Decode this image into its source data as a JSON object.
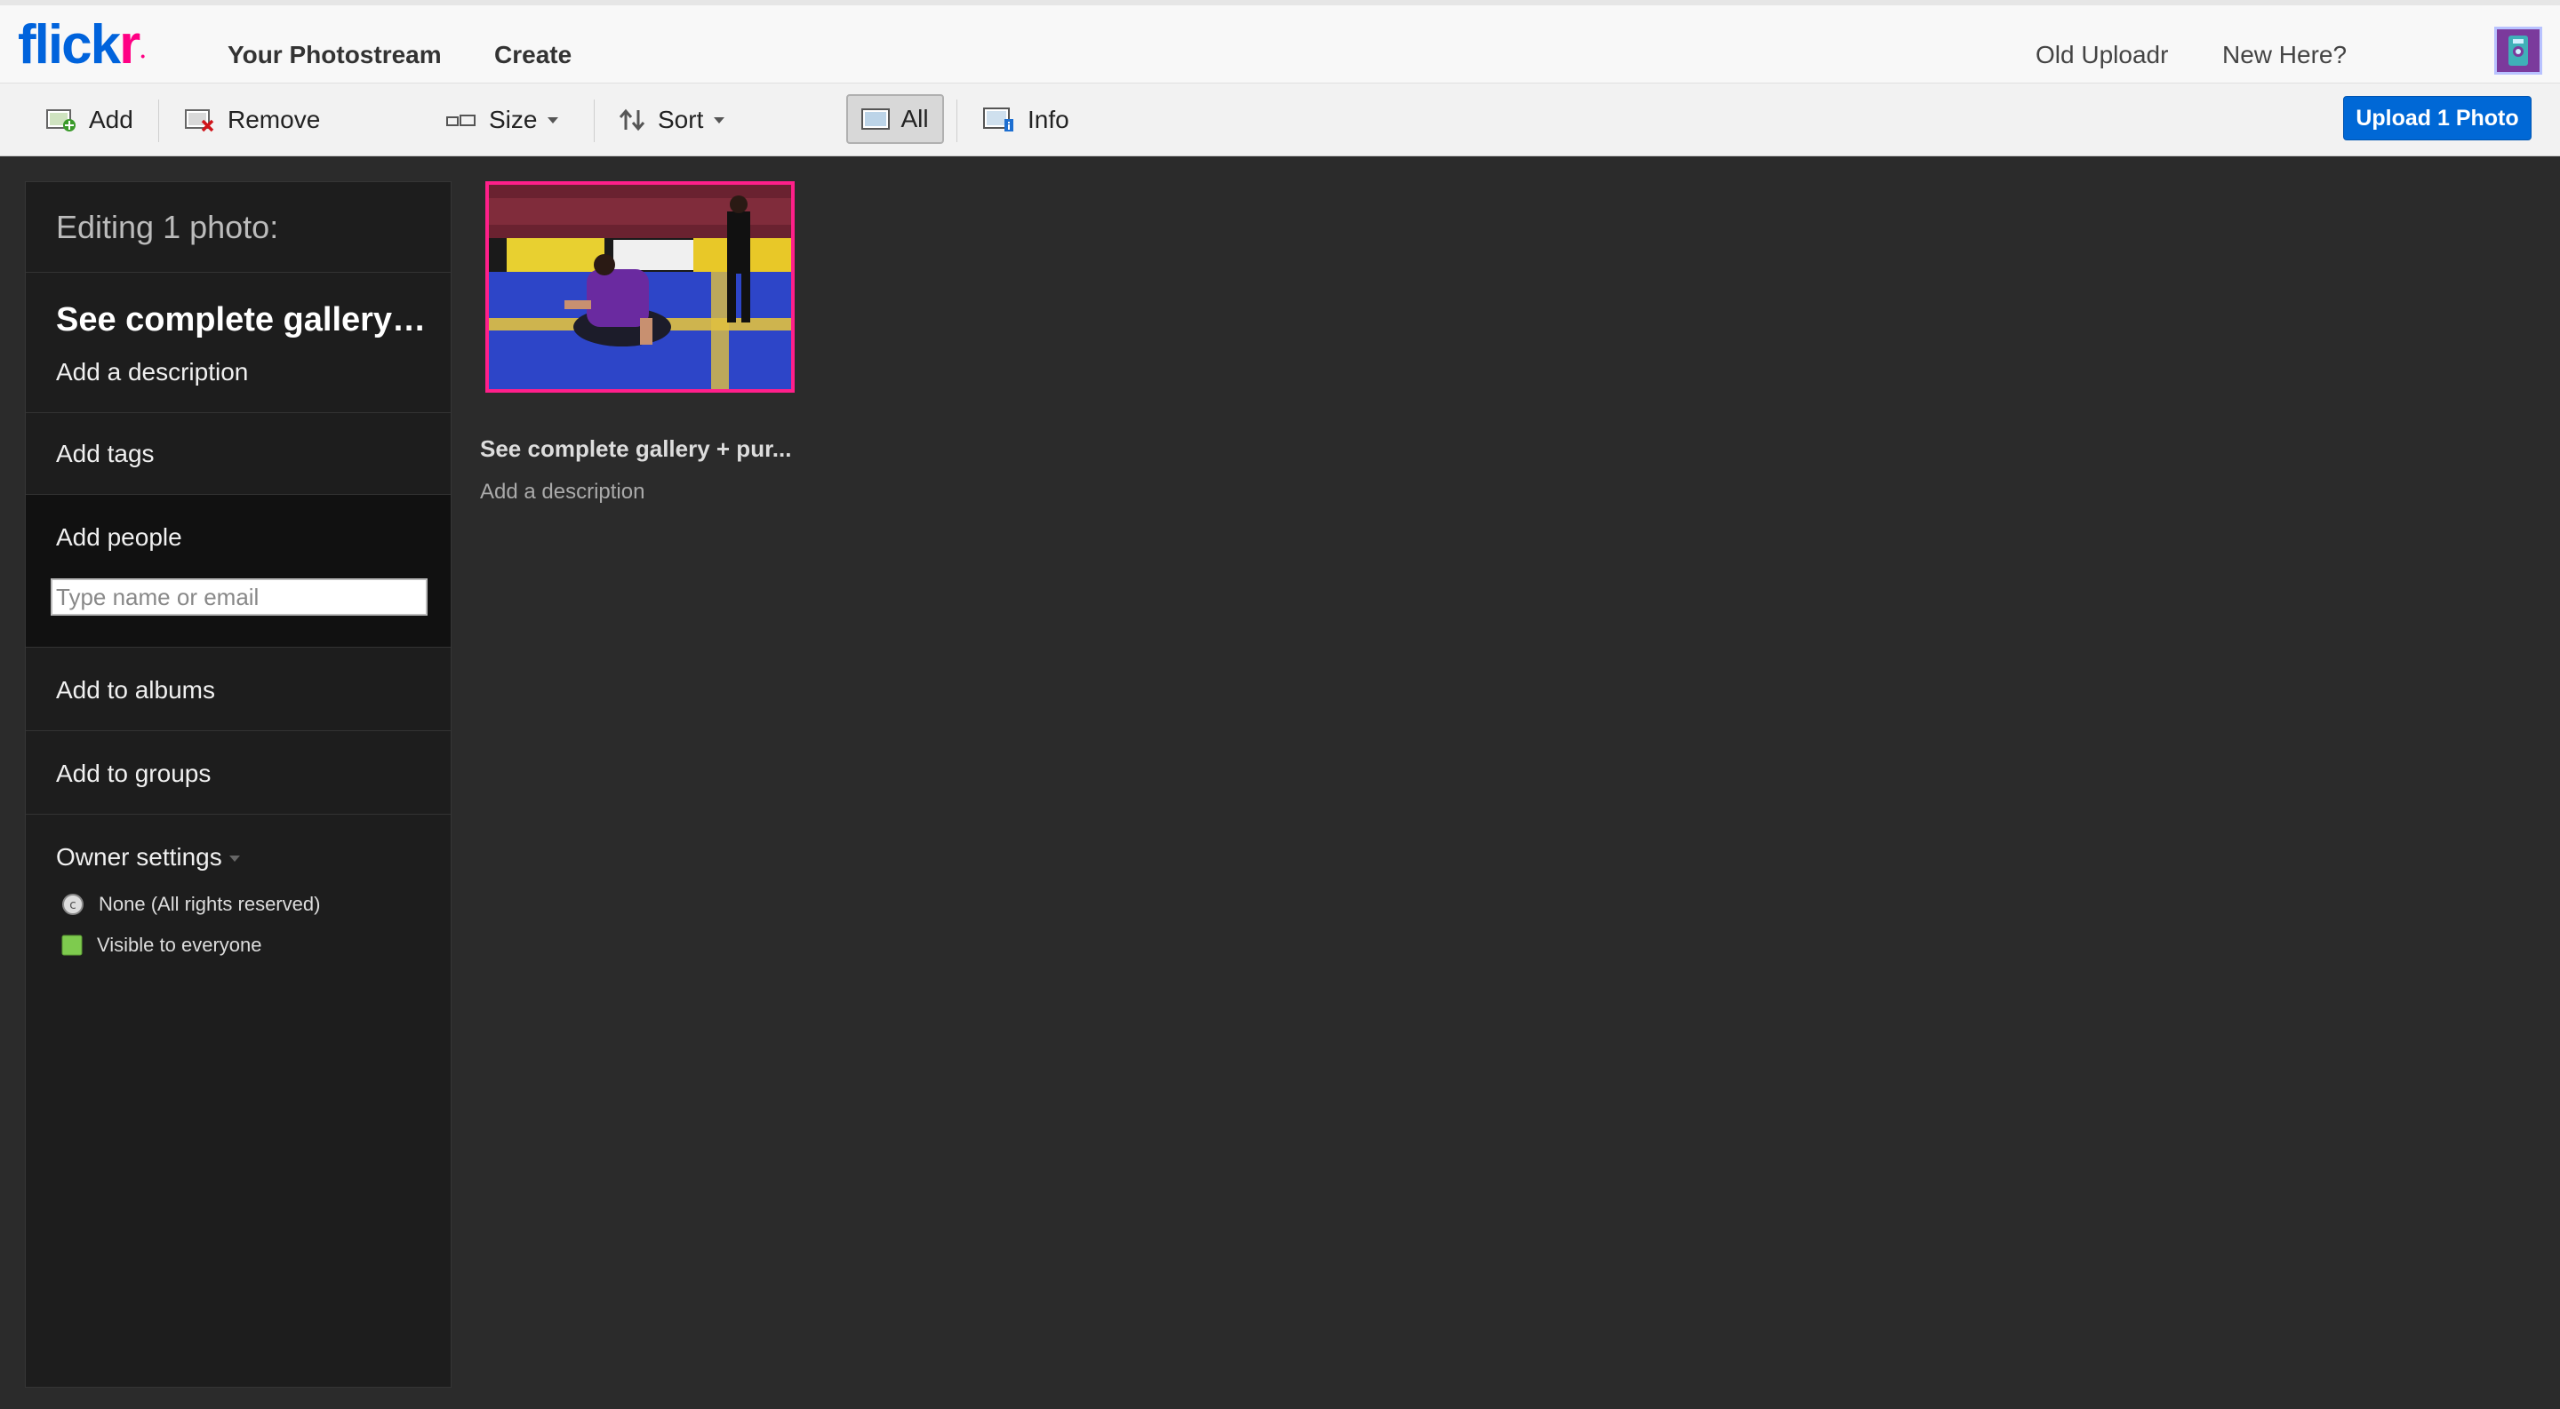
{
  "nav": {
    "logo_part1": "flick",
    "logo_part2": "r",
    "photostream": "Your Photostream",
    "create": "Create",
    "old_uploadr": "Old Uploadr",
    "new_here": "New Here?"
  },
  "toolbar": {
    "add": "Add",
    "remove": "Remove",
    "size": "Size",
    "sort": "Sort",
    "all": "All",
    "info": "Info",
    "upload": "Upload 1 Photo"
  },
  "sidebar": {
    "editing": "Editing 1 photo:",
    "title": "See complete gallery + purchase prints",
    "add_description": "Add a description",
    "add_tags": "Add tags",
    "add_people": "Add people",
    "people_placeholder": "Type name or email",
    "add_albums": "Add to albums",
    "add_groups": "Add to groups",
    "owner_settings": "Owner settings",
    "license": "None (All rights reserved)",
    "visibility": "Visible to everyone"
  },
  "photo": {
    "title": "See complete gallery + pur...",
    "description": "Add a description"
  },
  "colors": {
    "accent_blue": "#0068d6",
    "selection_pink": "#ff1f8a",
    "flickr_blue": "#0063dc",
    "flickr_pink": "#ff0084"
  }
}
